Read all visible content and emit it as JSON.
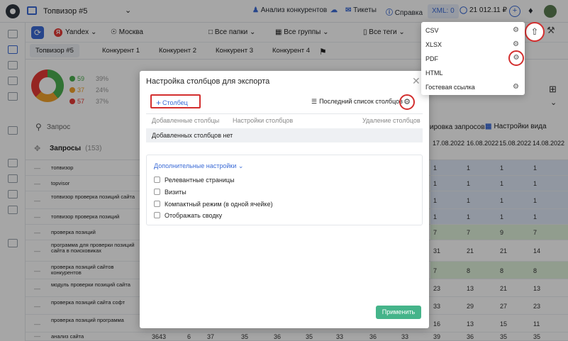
{
  "topbar": {
    "project": "Топвизор #5",
    "competitors": "Анализ конкурентов",
    "tickets": "Тикеты",
    "help": "Справка",
    "xml": "XML: 0",
    "balance": "21 012.11 ₽"
  },
  "filters": {
    "engine": "Yandex",
    "region": "Москва",
    "folders": "Все папки",
    "groups": "Все группы",
    "tags": "Все теги"
  },
  "tabs": [
    "Топвизор #5",
    "Конкурент 1",
    "Конкурент 2",
    "Конкурент 3",
    "Конкурент 4"
  ],
  "stats": [
    {
      "value": "59",
      "pct": "39%",
      "color": "#4caf50"
    },
    {
      "value": "37",
      "pct": "24%",
      "color": "#f2a12b"
    },
    {
      "value": "57",
      "pct": "37%",
      "color": "#e53935"
    }
  ],
  "table": {
    "search_placeholder": "Запрос",
    "sort_label": "ировка запросов",
    "view_label": "Настройки вида",
    "header_title": "Запросы",
    "header_count": "(153)",
    "dates": [
      "17.08.2022",
      "16.08.2022",
      "15.08.2022",
      "14.08.2022"
    ],
    "rows": [
      {
        "q": "топвизор",
        "c": [
          "1",
          "1",
          "1",
          "1"
        ]
      },
      {
        "q": "topvisor",
        "c": [
          "1",
          "1",
          "1",
          "1"
        ]
      },
      {
        "q": "топвизор проверка позиций сайта",
        "c": [
          "1",
          "1",
          "1",
          "1"
        ]
      },
      {
        "q": "топвизор проверка позиций",
        "c": [
          "1",
          "1",
          "1",
          "1"
        ]
      },
      {
        "q": "проверка позиций",
        "c": [
          "7",
          "7",
          "9",
          "7"
        ]
      },
      {
        "q": "программа для проверки позиций сайта в поисковиках",
        "c": [
          "31",
          "21",
          "21",
          "14"
        ]
      },
      {
        "q": "проверка позиций сайтов конкурентов",
        "c": [
          "7",
          "8",
          "8",
          "8"
        ]
      },
      {
        "q": "модуль проверки позиций сайта",
        "c": [
          "23",
          "13",
          "21",
          "13"
        ]
      },
      {
        "q": "проверка позиций сайта софт",
        "c": [
          "33",
          "29",
          "27",
          "23"
        ]
      },
      {
        "q": "проверка позиций программа",
        "c": [
          "16",
          "13",
          "15",
          "11"
        ]
      },
      {
        "q": "анализ сайта",
        "c": [
          "39",
          "36",
          "35",
          "35"
        ]
      }
    ],
    "last_row_extra": [
      "3643",
      "6",
      "37",
      "35",
      "36",
      "35",
      "33",
      "36",
      "33"
    ]
  },
  "modal": {
    "title": "Настройка столбцов для экспорта",
    "add_column": "Столбец",
    "last_list": "Последний список столбцов",
    "col_added": "Добавленные столбцы",
    "col_settings": "Настройки столбцов",
    "col_delete": "Удаление столбцов",
    "empty": "Добавленных столбцов нет",
    "advanced": "Дополнительные настройки",
    "checks": [
      "Релевантные страницы",
      "Визиты",
      "Компактный режим (в одной ячейке)",
      "Отображать сводку"
    ],
    "apply": "Применить"
  },
  "export_menu": [
    "CSV",
    "XLSX",
    "PDF",
    "HTML",
    "Гостевая ссылка"
  ]
}
